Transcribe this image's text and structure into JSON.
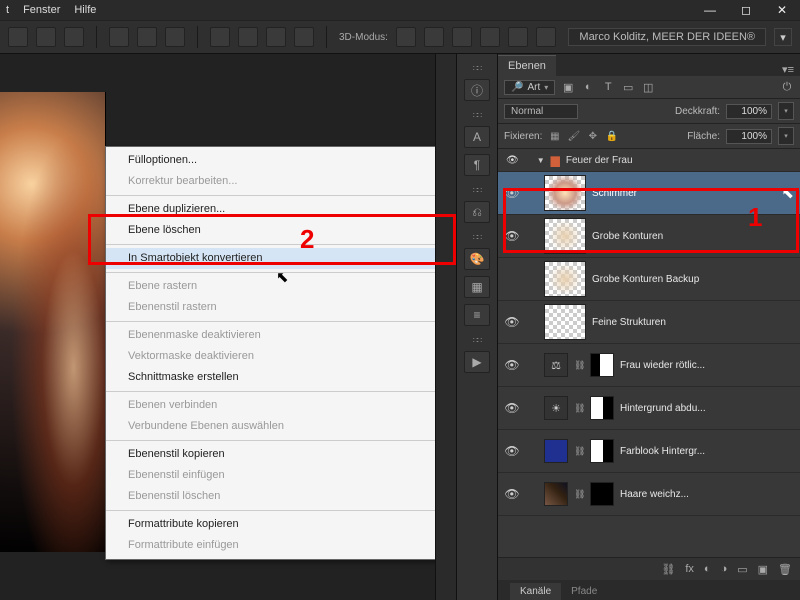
{
  "menubar": {
    "items": [
      "t",
      "Fenster",
      "Hilfe"
    ]
  },
  "window_controls": {
    "minimize": "—",
    "maximize": "◻",
    "close": "✕"
  },
  "toolbar": {
    "mode_label": "3D-Modus:",
    "user_label": "Marco Kolditz, MEER DER IDEEN®"
  },
  "context_menu": {
    "groups": [
      [
        {
          "label": "Fülloptionen...",
          "enabled": true
        },
        {
          "label": "Korrektur bearbeiten...",
          "enabled": false
        }
      ],
      [
        {
          "label": "Ebene duplizieren...",
          "enabled": true
        },
        {
          "label": "Ebene löschen",
          "enabled": true
        }
      ],
      [
        {
          "label": "In Smartobjekt konvertieren",
          "enabled": true,
          "hover": true
        }
      ],
      [
        {
          "label": "Ebene rastern",
          "enabled": false
        },
        {
          "label": "Ebenenstil rastern",
          "enabled": false
        }
      ],
      [
        {
          "label": "Ebenenmaske deaktivieren",
          "enabled": false
        },
        {
          "label": "Vektormaske deaktivieren",
          "enabled": false
        },
        {
          "label": "Schnittmaske erstellen",
          "enabled": true
        }
      ],
      [
        {
          "label": "Ebenen verbinden",
          "enabled": false
        },
        {
          "label": "Verbundene Ebenen auswählen",
          "enabled": false
        }
      ],
      [
        {
          "label": "Ebenenstil kopieren",
          "enabled": true
        },
        {
          "label": "Ebenenstil einfügen",
          "enabled": false
        },
        {
          "label": "Ebenenstil löschen",
          "enabled": false
        }
      ],
      [
        {
          "label": "Formattribute kopieren",
          "enabled": true
        },
        {
          "label": "Formattribute einfügen",
          "enabled": false
        }
      ]
    ]
  },
  "layers_panel": {
    "tab": "Ebenen",
    "filter_kind": "Art",
    "blend_mode": "Normal",
    "opacity_label": "Deckkraft:",
    "opacity_value": "100%",
    "lock_label": "Fixieren:",
    "fill_label": "Fläche:",
    "fill_value": "100%",
    "group_name": "Feuer der Frau",
    "layers": [
      {
        "name": "Schimmer",
        "selected": true,
        "visible": true,
        "thumb": "checker"
      },
      {
        "name": "Grobe Konturen",
        "visible": true,
        "thumb": "checker"
      },
      {
        "name": "Grobe Konturen Backup",
        "visible": false,
        "thumb": "checker"
      },
      {
        "name": "Feine Strukturen",
        "visible": true,
        "thumb": "checker"
      },
      {
        "name": "Frau wieder rötlic...",
        "visible": true,
        "thumb": "maskpair",
        "adj": "balance"
      },
      {
        "name": "Hintergrund abdu...",
        "visible": true,
        "thumb": "maskpair",
        "adj": "exposure"
      },
      {
        "name": "Farblook Hintergr...",
        "visible": true,
        "thumb": "maskpair",
        "adj": "solidblue"
      },
      {
        "name": "Haare weichz...",
        "visible": true,
        "thumb": "photo"
      }
    ],
    "bottom_tabs": [
      "Kanäle",
      "Pfade"
    ]
  },
  "annotations": {
    "marker1": "1",
    "marker2": "2"
  },
  "icons": {
    "eye": "👁",
    "link": "⛓",
    "gear": "⚙",
    "trash": "🗑",
    "newlayer": "▣",
    "mask": "◐",
    "fx": "fx",
    "folder": "📁",
    "palette": "🎨",
    "grid": "▦",
    "info": "ⓘ",
    "text": "A",
    "para": "¶",
    "history": "⟳",
    "brush": "🖌",
    "chain": "⛓"
  }
}
